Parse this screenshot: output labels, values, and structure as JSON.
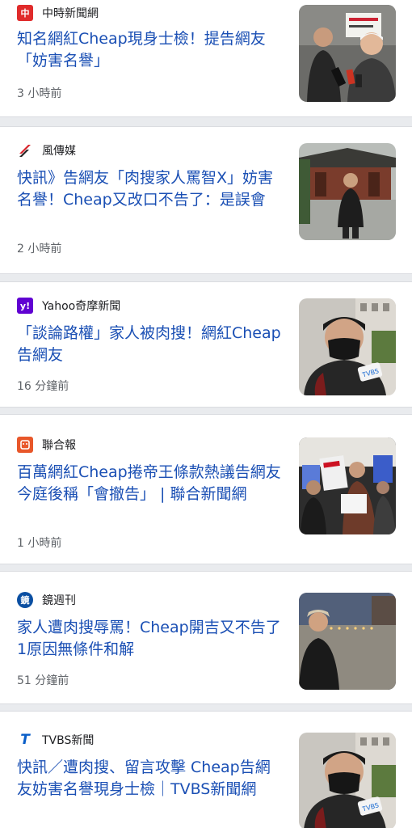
{
  "articles": [
    {
      "source": "中時新聞網",
      "logo_text": "中",
      "logo_color": "#e02b2b",
      "logo_icon": "chinatimes-logo-icon",
      "title": "知名網紅Cheap現身士檢！提告網友「妨害名譽」",
      "time": "3 小時前",
      "thumb_desc": "press-scrum-photo"
    },
    {
      "source": "風傳媒",
      "logo_text": "",
      "logo_color": "#ffffff",
      "logo_icon": "storm-media-logo-icon",
      "title": "快訊》告網友「肉搜家人罵智X」妨害名譽！Cheap又改口不告了：是誤會",
      "time": "2 小時前",
      "thumb_desc": "temple-courtyard-photo"
    },
    {
      "source": "Yahoo奇摩新聞",
      "logo_text": "y!",
      "logo_color": "#6001d2",
      "logo_icon": "yahoo-logo-icon",
      "title": "「談論路權」家人被肉搜！網紅Cheap告網友",
      "time": "16 分鐘前",
      "thumb_desc": "masked-man-microphone-photo"
    },
    {
      "source": "聯合報",
      "logo_text": "",
      "logo_color": "#e8572a",
      "logo_icon": "udn-logo-icon",
      "title": "百萬網紅Cheap捲帝王條款熱議告網友今庭後稱「會撤告」 | 聯合新聞網",
      "time": "1 小時前",
      "thumb_desc": "protest-signs-photo"
    },
    {
      "source": "鏡週刊",
      "logo_text": "鏡",
      "logo_color": "#0b4fa2",
      "logo_icon": "mirror-media-logo-icon",
      "title": "家人遭肉搜辱罵！Cheap開吉又不告了 1原因無條件和解",
      "time": "51 分鐘前",
      "thumb_desc": "night-plaza-photo"
    },
    {
      "source": "TVBS新聞",
      "logo_text": "T",
      "logo_color": "#ffffff",
      "logo_icon": "tvbs-logo-icon",
      "title": "快訊／遭肉搜、留言攻擊 Cheap告網友妨害名譽現身士檢｜TVBS新聞網",
      "time": "",
      "thumb_desc": "masked-man-microphone-photo"
    }
  ]
}
